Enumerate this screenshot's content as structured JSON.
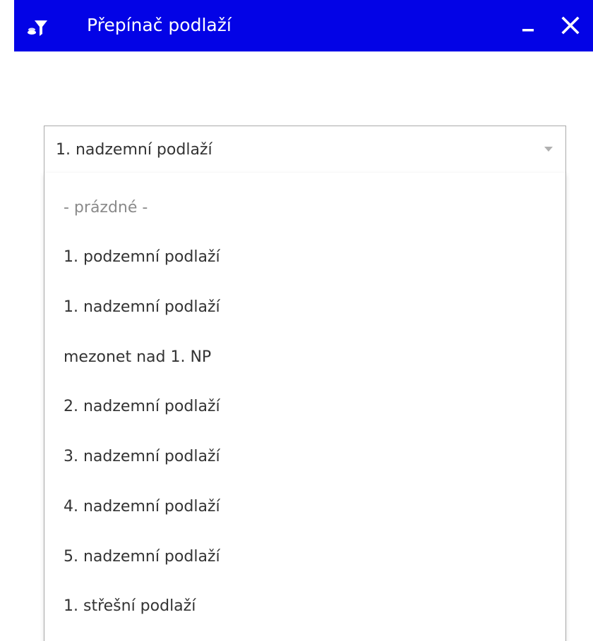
{
  "window": {
    "title": "Přepínač podlaží",
    "icon": "floor-filter-icon",
    "minimize_label": "–",
    "close_label": "✕"
  },
  "colors": {
    "titlebar_bg": "#0303e6",
    "titlebar_fg": "#ffffff",
    "text": "#333333",
    "placeholder_text": "#8a8a8a",
    "border": "#a9a9a9"
  },
  "floor_select": {
    "selected_value": "1. nadzemní podlaží",
    "options": [
      "- prázdné -",
      "1. podzemní podlaží",
      "1. nadzemní podlaží",
      "mezonet nad 1. NP",
      "2. nadzemní podlaží",
      "3. nadzemní podlaží",
      "4. nadzemní podlaží",
      "5. nadzemní podlaží",
      "1. střešní podlaží"
    ]
  }
}
